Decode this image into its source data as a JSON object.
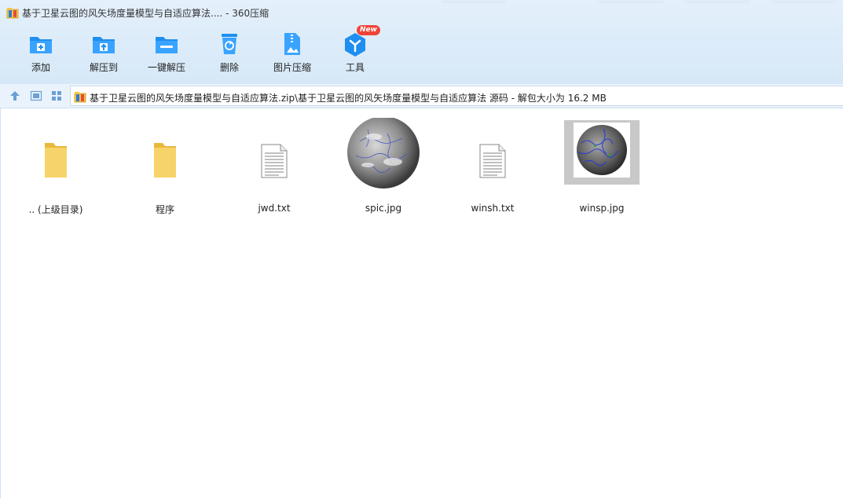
{
  "window": {
    "title": "基于卫星云图的风矢场度量模型与自适应算法.... - 360压缩",
    "app_icon": "archive-icon"
  },
  "toolbar": {
    "items": [
      {
        "label": "添加",
        "icon": "add-folder-icon"
      },
      {
        "label": "解压到",
        "icon": "extract-to-icon"
      },
      {
        "label": "一键解压",
        "icon": "one-click-extract-icon"
      },
      {
        "label": "删除",
        "icon": "recycle-bin-icon"
      },
      {
        "label": "图片压缩",
        "icon": "image-compress-icon"
      },
      {
        "label": "工具",
        "icon": "tools-icon",
        "badge": "New"
      }
    ]
  },
  "nav": {
    "path": "基于卫星云图的风矢场度量模型与自适应算法.zip\\基于卫星云图的风矢场度量模型与自适应算法 源码 - 解包大小为 16.2 MB"
  },
  "files": [
    {
      "name": ".. (上级目录)",
      "type": "folder"
    },
    {
      "name": "程序",
      "type": "folder"
    },
    {
      "name": "jwd.txt",
      "type": "text"
    },
    {
      "name": "spic.jpg",
      "type": "image-globe"
    },
    {
      "name": "winsh.txt",
      "type": "text"
    },
    {
      "name": "winsp.jpg",
      "type": "image-globe-framed"
    }
  ],
  "colors": {
    "accent": "#1e8ff0",
    "topbar": "#dcecfa",
    "folder": "#f7d46a",
    "badge": "#f04438"
  }
}
